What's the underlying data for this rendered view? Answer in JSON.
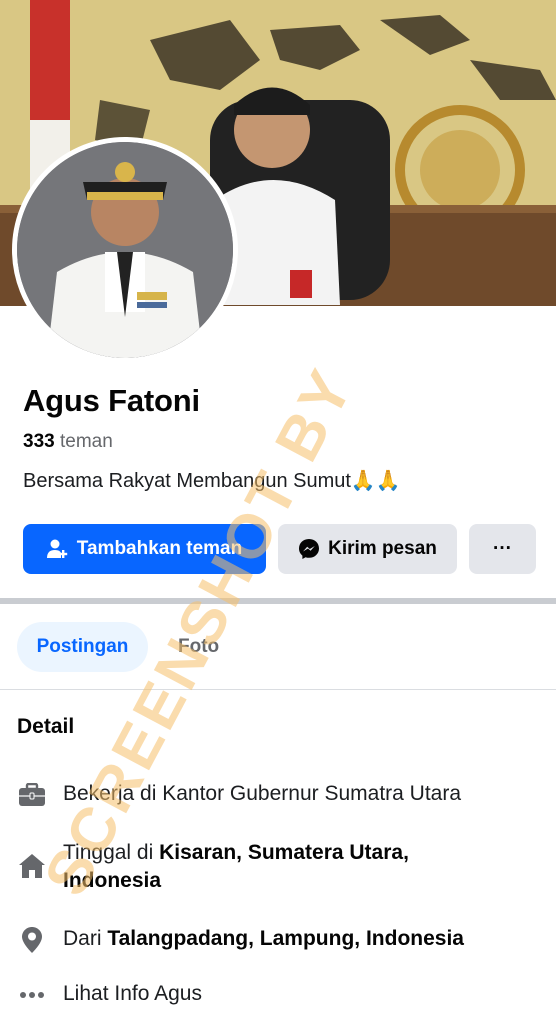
{
  "profile": {
    "name": "Agus Fatoni",
    "friend_count": "333",
    "friend_label": "teman",
    "bio": "Bersama Rakyat Membangun Sumut🙏🙏"
  },
  "actions": {
    "add_friend": "Tambahkan teman",
    "message": "Kirim pesan",
    "more": "···"
  },
  "tabs": [
    {
      "label": "Postingan",
      "active": true
    },
    {
      "label": "Foto",
      "active": false
    }
  ],
  "detail": {
    "heading": "Detail",
    "work": "Bekerja di Kantor Gubernur Sumatra Utara",
    "lives_prefix": "Tinggal di ",
    "lives_place": "Kisaran, Sumatera Utara, Indonesia",
    "from_prefix": "Dari ",
    "from_place": "Talangpadang, Lampung, Indonesia",
    "more_info": "Lihat Info Agus"
  },
  "watermark": "SCREENSHOT BY",
  "colors": {
    "primary": "#0866ff",
    "secondary_bg": "#e4e6eb",
    "tab_active_bg": "#ebf5ff",
    "muted_text": "#65676b",
    "watermark": "#f5c06a"
  },
  "icons": [
    "user-plus-icon",
    "messenger-icon",
    "briefcase-icon",
    "home-icon",
    "location-pin-icon",
    "more-dots-icon"
  ]
}
